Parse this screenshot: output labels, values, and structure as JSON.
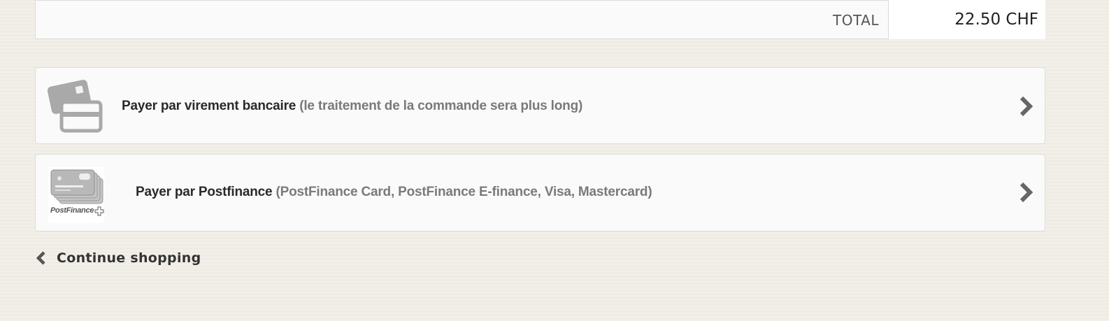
{
  "cart": {
    "total_label": "TOTAL",
    "total_value": "22.50 CHF"
  },
  "payment_options": [
    {
      "label": "Payer par virement bancaire",
      "note": "(le traitement de la commande sera plus long)",
      "icon": "credit-card-icon"
    },
    {
      "label": "Payer par Postfinance",
      "note": "(PostFinance Card, PostFinance E-finance, Visa, Mastercard)",
      "icon": "postfinance-logo",
      "logo_text": "PostFinance"
    }
  ],
  "continue_shopping": {
    "label": "Continue shopping",
    "icon": "chevron-left-icon"
  },
  "colors": {
    "background": "#f2efe9",
    "panel": "#fafafa",
    "border": "#dcdcdc",
    "text_dark": "#2a2a2a",
    "text_muted": "#7a7a7a",
    "icon_gray": "#9a9a9a"
  }
}
